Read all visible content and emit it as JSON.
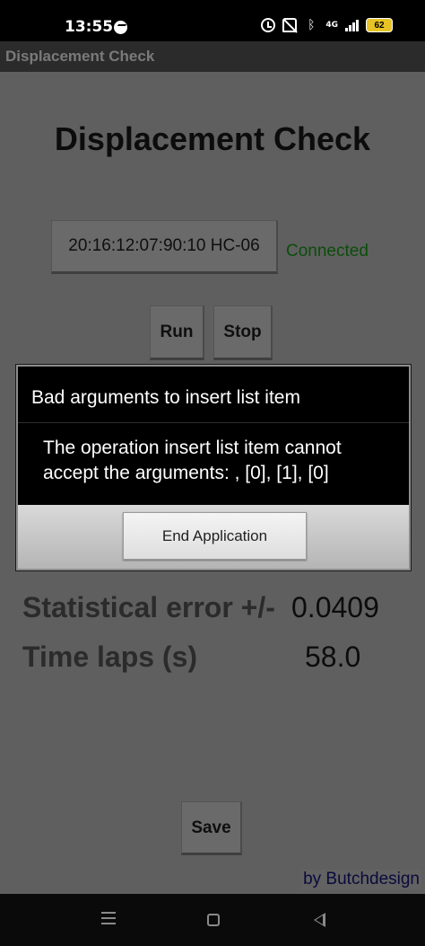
{
  "status_bar": {
    "time": "13:55",
    "network_label": "4G",
    "battery_level": "62"
  },
  "app_bar": {
    "title": "Displacement Check"
  },
  "main": {
    "title": "Displacement Check",
    "device_button": "20:16:12:07:90:10 HC-06",
    "connection_status": "Connected",
    "run_label": "Run",
    "stop_label": "Stop",
    "stats": [
      {
        "label": "Statistical error +/-",
        "value": "0.0409"
      },
      {
        "label": "Time laps (s)",
        "value": "58.0"
      }
    ],
    "save_label": "Save",
    "credit": "by Butchdesign"
  },
  "dialog": {
    "title": "Bad arguments to insert list item",
    "message": "The operation insert list item cannot accept the arguments: , [0], [1], [0]",
    "button_label": "End Application"
  },
  "colors": {
    "connected": "#0b4d0b",
    "credit": "#0a0a3c",
    "battery": "#e8c325"
  }
}
